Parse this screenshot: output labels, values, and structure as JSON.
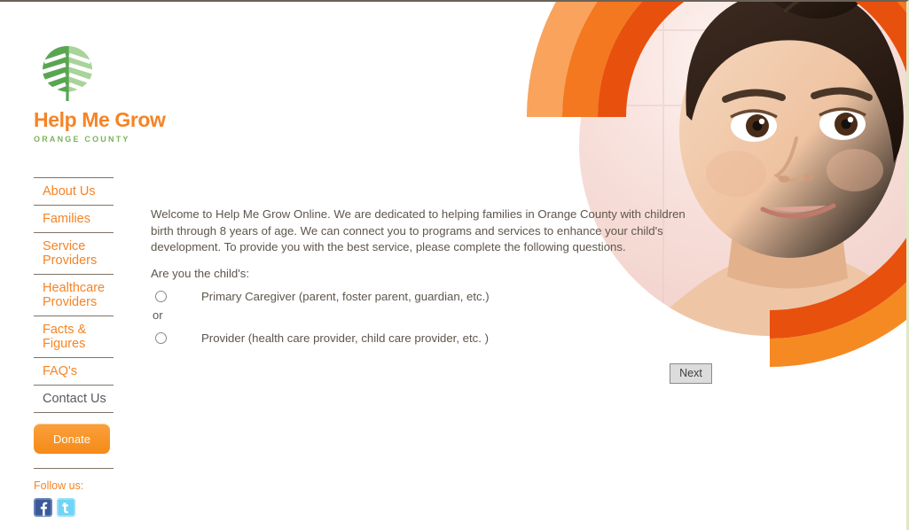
{
  "site": {
    "logo": {
      "icon": "leaf-icon",
      "wordmark": "Help Me Grow",
      "subtitle": "ORANGE COUNTY"
    },
    "brand_colors": {
      "orange": "#f58426",
      "orange_dark": "#e8500e",
      "orange_mid": "#f4781f",
      "orange_light": "#f9a05a",
      "green_dark": "#5aa552",
      "green_light": "#a8d39a",
      "green_border": "#dfe8c4",
      "text": "#5d564c",
      "rule": "#7d7366"
    }
  },
  "sidebar": {
    "nav": [
      {
        "label": "About Us",
        "current": false
      },
      {
        "label": "Families",
        "current": false
      },
      {
        "label": "Service\nProviders",
        "current": false
      },
      {
        "label": "Healthcare\nProviders",
        "current": false
      },
      {
        "label": "Facts &\nFigures",
        "current": false
      },
      {
        "label": "FAQ's",
        "current": false
      },
      {
        "label": "Contact Us",
        "current": true
      }
    ],
    "donate_label": "Donate",
    "follow_label": "Follow us:",
    "social": [
      {
        "name": "facebook-icon",
        "glyph": "f"
      },
      {
        "name": "twitter-icon",
        "glyph": "t"
      }
    ]
  },
  "main": {
    "intro": "Welcome to Help Me Grow Online. We are dedicated to helping families in Orange County with children birth through 8 years of age. We can connect you to programs and services to enhance your child's development. To provide you with the best service, please complete the following questions.",
    "question": "Are you the child's:",
    "option_primary": "Primary Caregiver (parent, foster parent, guardian, etc.)",
    "or": "or",
    "option_provider": "Provider (health care provider, child care provider, etc. )",
    "next_label": "Next"
  },
  "hero": {
    "description": "Circular photo of a smiling toddler with wet dark hair, framed by concentric orange arcs"
  }
}
